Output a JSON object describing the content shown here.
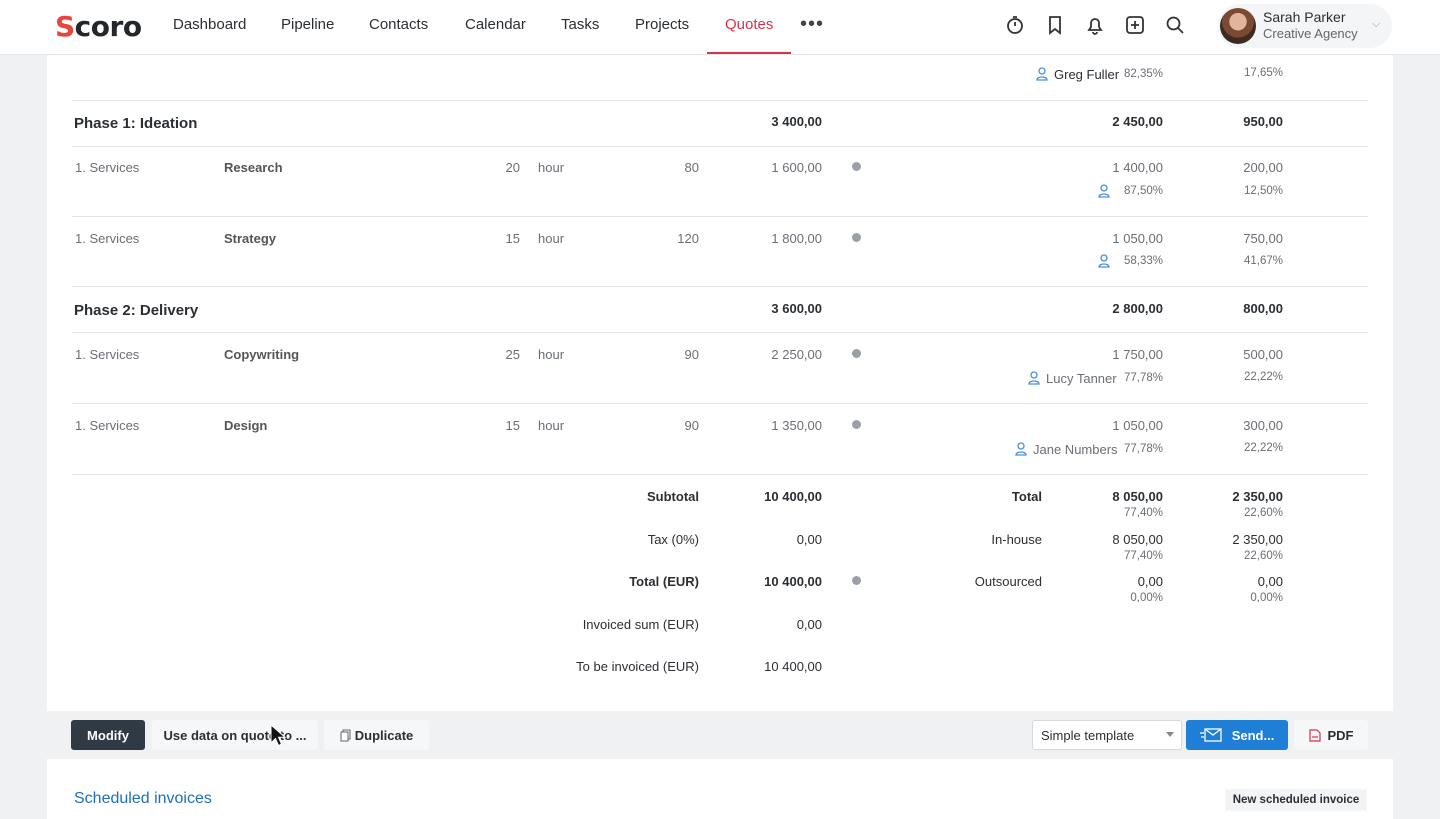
{
  "app": {
    "logo": "Scoro"
  },
  "nav": {
    "items": [
      "Dashboard",
      "Pipeline",
      "Contacts",
      "Calendar",
      "Tasks",
      "Projects",
      "Quotes"
    ],
    "active": "Quotes",
    "more": "•••"
  },
  "user": {
    "name": "Sarah Parker",
    "company": "Creative Agency"
  },
  "top_row": {
    "person": "Greg Fuller",
    "pct": "82,35%",
    "pct2": "17,65%"
  },
  "phases": [
    {
      "name": "Phase 1: Ideation",
      "total": "3 400,00",
      "inhouse": "2 450,00",
      "out": "950,00"
    },
    {
      "name": "Phase 2: Delivery",
      "total": "3 600,00",
      "inhouse": "2 800,00",
      "out": "800,00"
    }
  ],
  "rows": [
    {
      "group": "1. Services",
      "name": "Research",
      "qty": "20",
      "unit": "hour",
      "price": "80",
      "sum": "1 600,00",
      "cost": "1 400,00",
      "margin": "200,00",
      "person": "",
      "pct": "87,50%",
      "pct2": "12,50%"
    },
    {
      "group": "1. Services",
      "name": "Strategy",
      "qty": "15",
      "unit": "hour",
      "price": "120",
      "sum": "1 800,00",
      "cost": "1 050,00",
      "margin": "750,00",
      "person": "",
      "pct": "58,33%",
      "pct2": "41,67%"
    },
    {
      "group": "1. Services",
      "name": "Copywriting",
      "qty": "25",
      "unit": "hour",
      "price": "90",
      "sum": "2 250,00",
      "cost": "1 750,00",
      "margin": "500,00",
      "person": "Lucy Tanner",
      "pct": "77,78%",
      "pct2": "22,22%"
    },
    {
      "group": "1. Services",
      "name": "Design",
      "qty": "15",
      "unit": "hour",
      "price": "90",
      "sum": "1 350,00",
      "cost": "1 050,00",
      "margin": "300,00",
      "person": "Jane Numbers",
      "pct": "77,78%",
      "pct2": "22,22%"
    }
  ],
  "summary": {
    "subtotal_label": "Subtotal",
    "subtotal": "10 400,00",
    "tax_label": "Tax (0%)",
    "tax": "0,00",
    "total_label": "Total (EUR)",
    "total": "10 400,00",
    "invoiced_label": "Invoiced sum (EUR)",
    "invoiced": "0,00",
    "tobe_label": "To be invoiced (EUR)",
    "tobe": "10 400,00"
  },
  "breakdown": {
    "total_label": "Total",
    "total_a": "8 050,00",
    "total_ap": "77,40%",
    "total_b": "2 350,00",
    "total_bp": "22,60%",
    "inhouse_label": "In-house",
    "inhouse_a": "8 050,00",
    "inhouse_ap": "77,40%",
    "inhouse_b": "2 350,00",
    "inhouse_bp": "22,60%",
    "out_label": "Outsourced",
    "out_a": "0,00",
    "out_ap": "0,00%",
    "out_b": "0,00",
    "out_bp": "0,00%"
  },
  "actions": {
    "modify": "Modify",
    "use_data": "Use data on quote to ...",
    "duplicate": "Duplicate",
    "template": "Simple template",
    "send": "Send...",
    "pdf": "PDF"
  },
  "scheduled": {
    "title": "Scheduled invoices",
    "new": "New scheduled invoice"
  },
  "colors": {
    "accent": "#d6334b",
    "primary_button": "#1f7fd6",
    "link": "#1f6fb5"
  }
}
